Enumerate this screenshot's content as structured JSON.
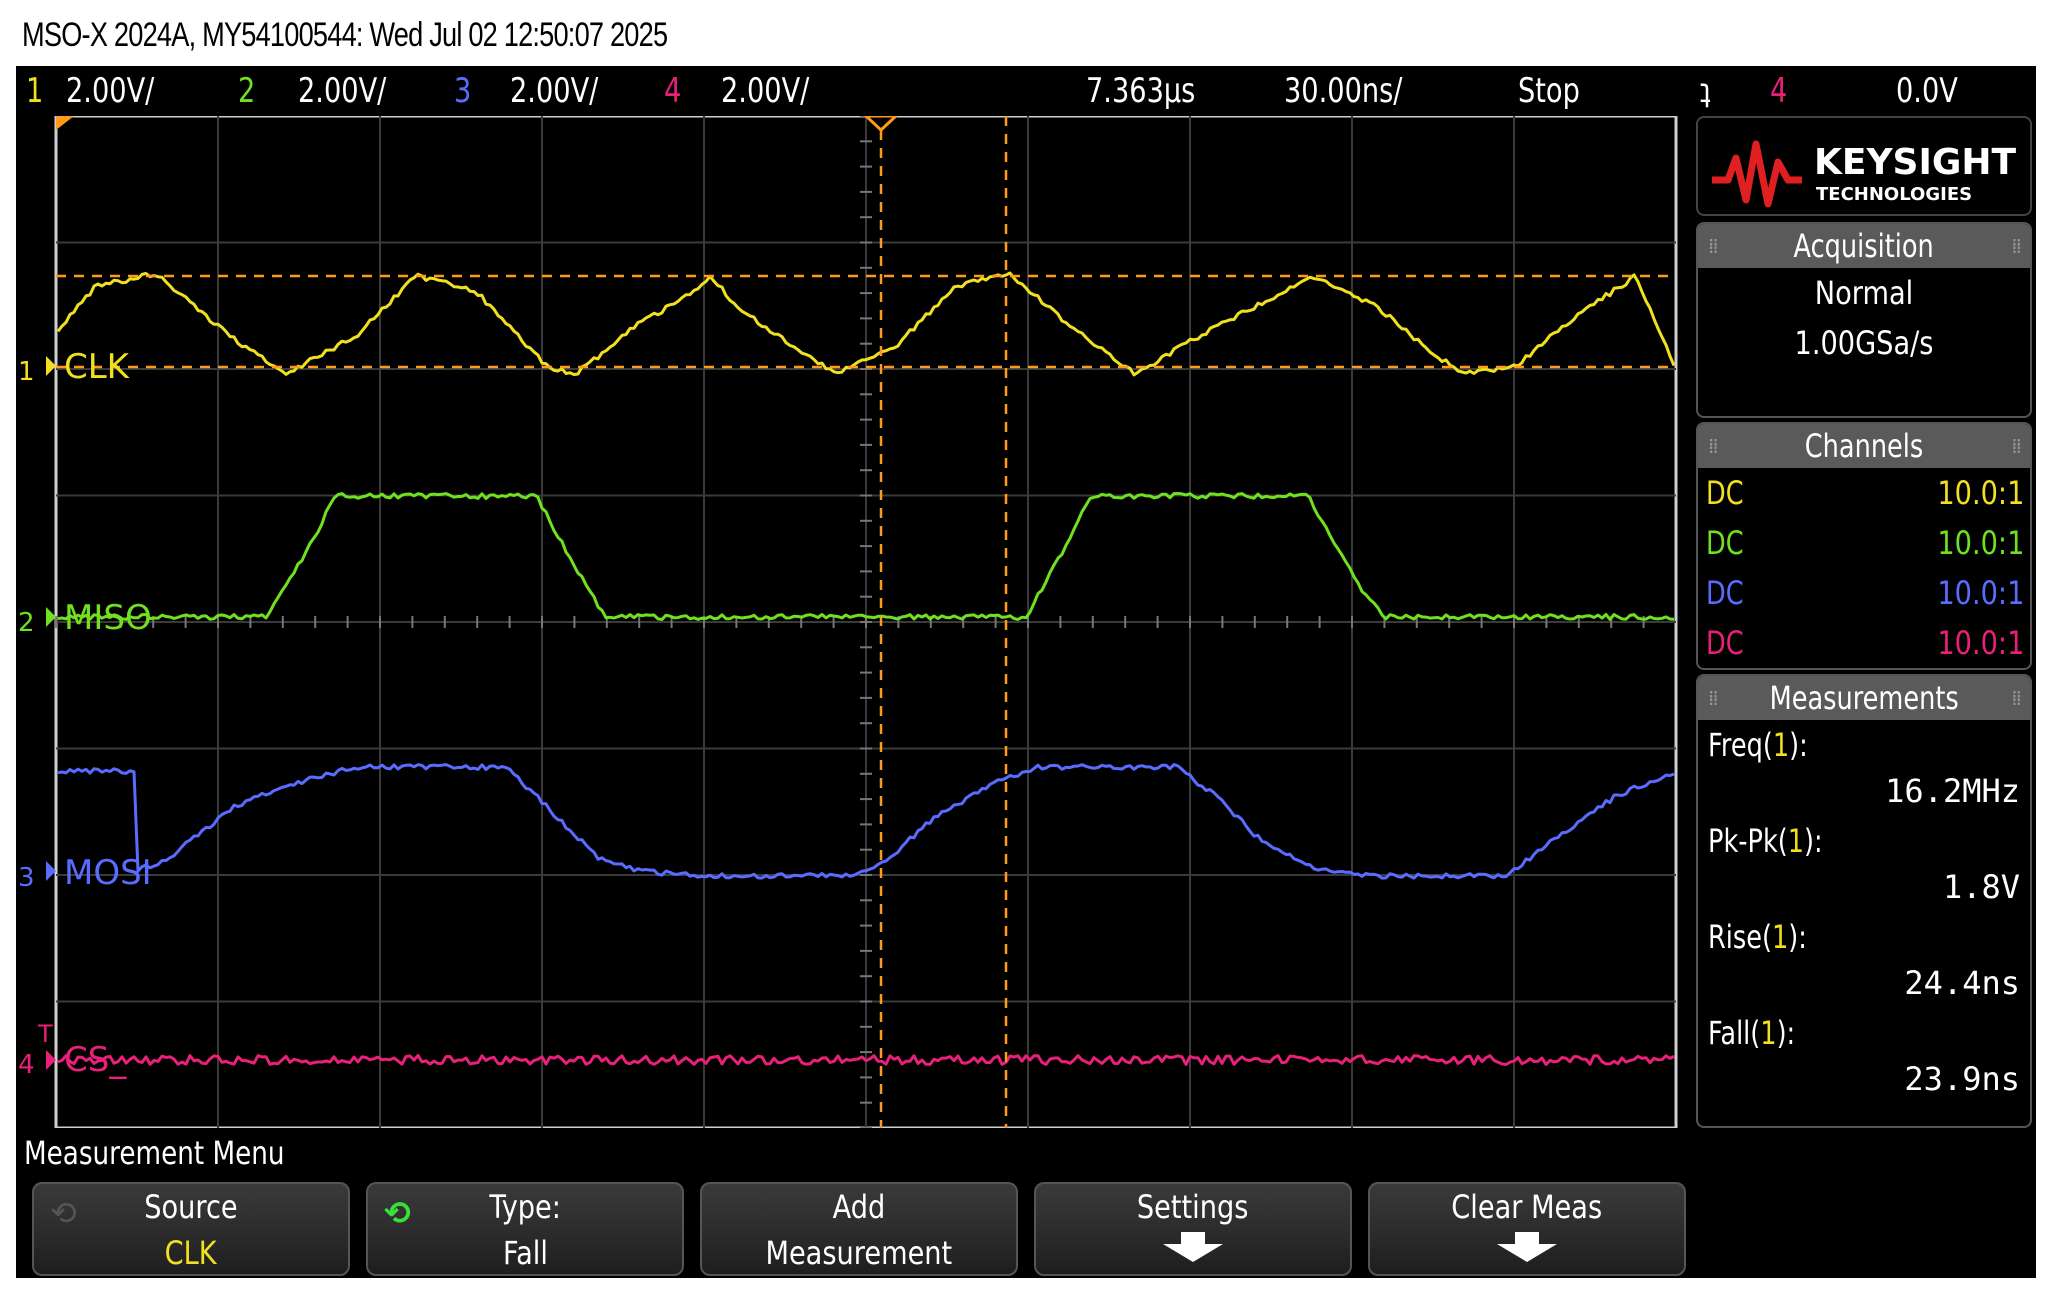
{
  "title": "MSO-X 2024A, MY54100544: Wed Jul 02 12:50:07 2025",
  "status": {
    "channels": [
      {
        "num": "1",
        "scale": "2.00V/",
        "color": "#f0e020"
      },
      {
        "num": "2",
        "scale": "2.00V/",
        "color": "#70e020"
      },
      {
        "num": "3",
        "scale": "2.00V/",
        "color": "#5a6cff"
      },
      {
        "num": "4",
        "scale": "2.00V/",
        "color": "#e8207a"
      }
    ],
    "delay": "7.363µs",
    "timebase": "30.00ns/",
    "run_state": "Stop",
    "trigger_slope": "ʇ",
    "trigger_source": "4",
    "trigger_level": "0.0V"
  },
  "traces": [
    {
      "label": "CLK",
      "num": "1",
      "color": "#f0e020"
    },
    {
      "label": "MISO",
      "num": "2",
      "color": "#70e020"
    },
    {
      "label": "MOSI",
      "num": "3",
      "color": "#5a6cff"
    },
    {
      "label": "CS_",
      "num": "4",
      "color": "#e8207a"
    }
  ],
  "brand": {
    "name": "KEYSIGHT",
    "sub": "TECHNOLOGIES"
  },
  "acquisition": {
    "title": "Acquisition",
    "mode": "Normal",
    "rate": "1.00GSa/s"
  },
  "channels_panel": {
    "title": "Channels",
    "rows": [
      {
        "coupling": "DC",
        "probe": "10.0:1",
        "color": "#f0e020"
      },
      {
        "coupling": "DC",
        "probe": "10.0:1",
        "color": "#70e020"
      },
      {
        "coupling": "DC",
        "probe": "10.0:1",
        "color": "#5a6cff"
      },
      {
        "coupling": "DC",
        "probe": "10.0:1",
        "color": "#e8207a"
      }
    ]
  },
  "measurements": {
    "title": "Measurements",
    "items": [
      {
        "name": "Freq",
        "src": "1",
        "value": "16.2MHz"
      },
      {
        "name": "Pk-Pk",
        "src": "1",
        "value": "1.8V"
      },
      {
        "name": "Rise",
        "src": "1",
        "value": "24.4ns"
      },
      {
        "name": "Fall",
        "src": "1",
        "value": "23.9ns"
      }
    ]
  },
  "menu": {
    "title": "Measurement Menu",
    "keys": [
      {
        "line1": "Source",
        "line2": "CLK"
      },
      {
        "line1": "Type:",
        "line2": "Fall"
      },
      {
        "line1": "Add",
        "line2": "Measurement"
      },
      {
        "line1": "Settings",
        "line2": ""
      },
      {
        "line1": "Clear Meas",
        "line2": ""
      }
    ]
  },
  "colors": {
    "cursor": "#ff9a1a",
    "grid": "#444444",
    "source_highlight": "#f0e020"
  }
}
